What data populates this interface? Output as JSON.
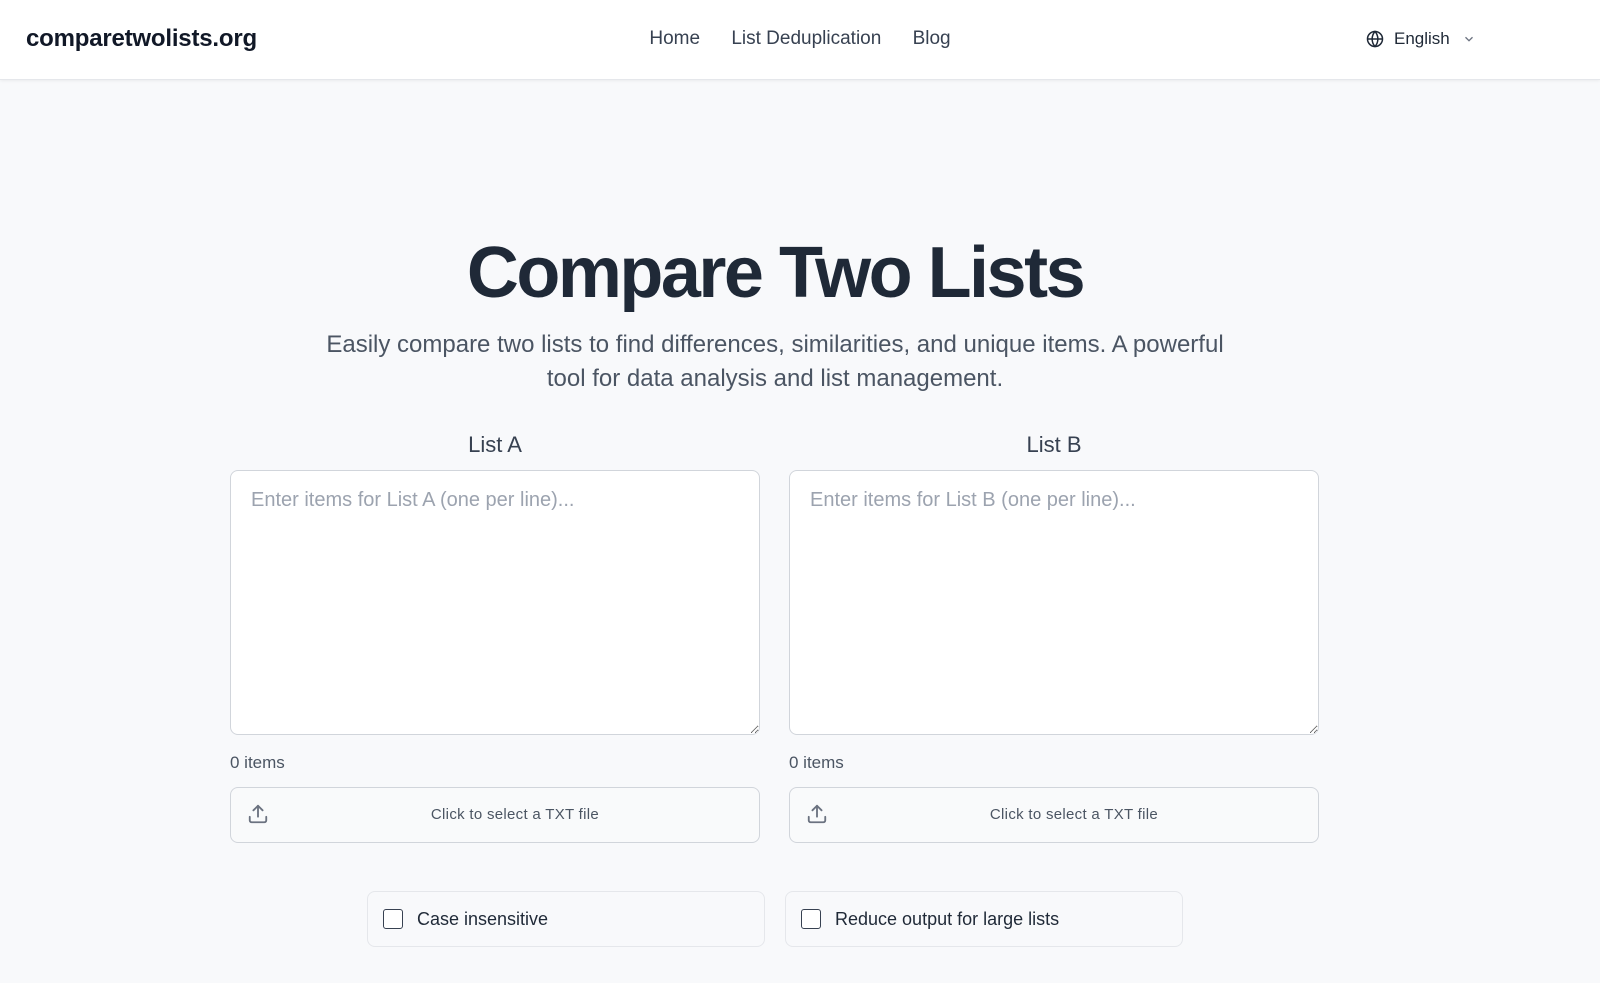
{
  "header": {
    "brand": "comparetwolists.org",
    "nav": [
      "Home",
      "List Deduplication",
      "Blog"
    ],
    "language": "English"
  },
  "hero": {
    "title": "Compare Two Lists",
    "subtitle": "Easily compare two lists to find differences, similarities, and unique items. A powerful tool for data analysis and list management."
  },
  "lists": {
    "a": {
      "label": "List A",
      "value": "",
      "placeholder": "Enter items for List A (one per line)...",
      "count": "0 items",
      "upload_label": "Click to select a TXT file"
    },
    "b": {
      "label": "List B",
      "value": "",
      "placeholder": "Enter items for List B (one per line)...",
      "count": "0 items",
      "upload_label": "Click to select a TXT file"
    }
  },
  "options": {
    "case_insensitive": {
      "label": "Case insensitive",
      "checked": false
    },
    "reduce_output": {
      "label": "Reduce output for large lists",
      "checked": false
    }
  },
  "icons": {
    "language": "globe-icon",
    "dropdown": "chevron-down-icon",
    "upload": "upload-icon"
  },
  "colors": {
    "page_background": "#f8f9fb",
    "heading": "#1f2937",
    "muted_text": "#4b5563",
    "border": "#d1d5db"
  }
}
